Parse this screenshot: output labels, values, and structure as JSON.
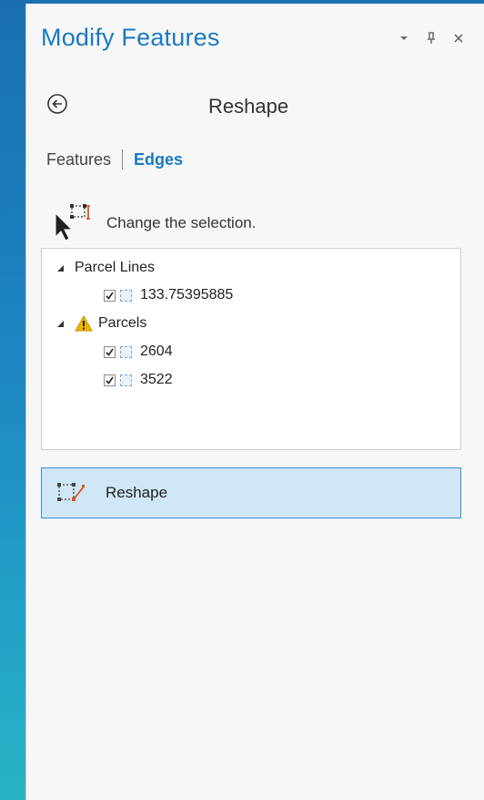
{
  "pane": {
    "title": "Modify Features",
    "controls": [
      "dropdown-icon",
      "pin-icon",
      "close-icon"
    ]
  },
  "header": {
    "heading": "Reshape",
    "back_icon": "back-arrow-icon"
  },
  "tabs": [
    {
      "label": "Features",
      "active": false
    },
    {
      "label": "Edges",
      "active": true
    }
  ],
  "selection": {
    "icon": "select-edit-cursor-icon",
    "text": "Change the selection."
  },
  "tree": {
    "groups": [
      {
        "label": "Parcel Lines",
        "warning": false,
        "items": [
          {
            "label": "133.75395885",
            "checked": true
          }
        ]
      },
      {
        "label": "Parcels",
        "warning": true,
        "items": [
          {
            "label": "2604",
            "checked": true
          },
          {
            "label": "3522",
            "checked": true
          }
        ]
      }
    ]
  },
  "tool": {
    "label": "Reshape",
    "icon": "reshape-tool-icon",
    "selected": true
  },
  "colors": {
    "accent": "#1a7abf",
    "tool_selected_bg": "#cfe6f6",
    "tool_selected_border": "#3b8fd0",
    "warning": "#f0b400"
  }
}
